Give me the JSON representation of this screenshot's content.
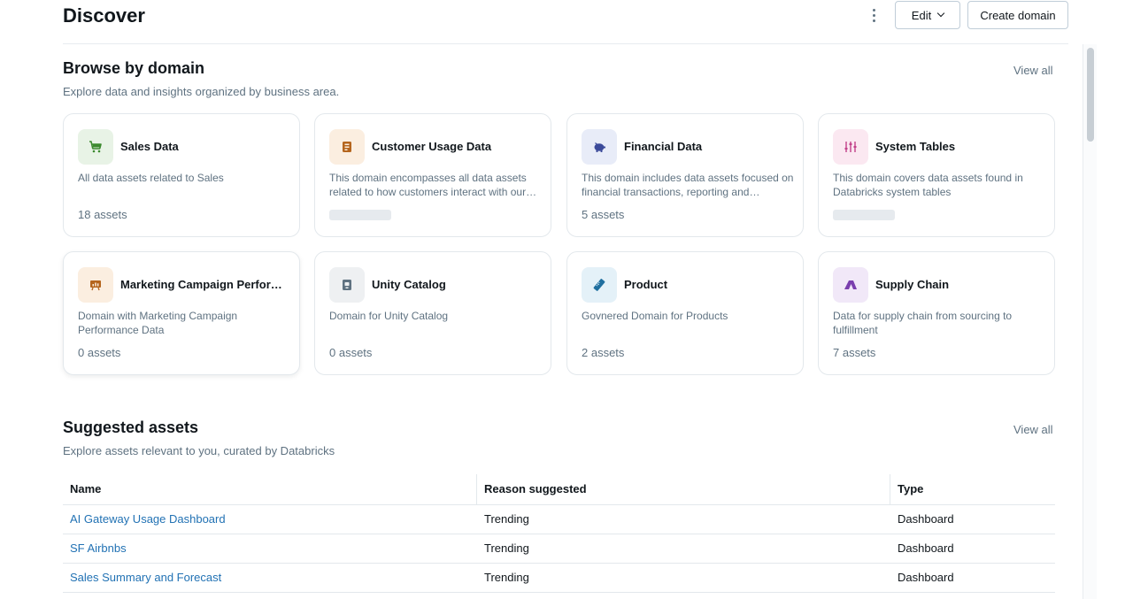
{
  "header": {
    "title": "Discover",
    "edit_label": "Edit",
    "create_label": "Create domain"
  },
  "browse": {
    "title": "Browse by domain",
    "subtitle": "Explore data and insights organized by business area.",
    "view_all": "View all",
    "domains": [
      {
        "name": "Sales Data",
        "description": "All data assets related to Sales",
        "count": "18 assets",
        "icon": "cart-icon",
        "icon_bg": "#e8f3e6",
        "icon_color": "#3b8a2e"
      },
      {
        "name": "Customer Usage Data",
        "description": "This domain encompasses all data assets related to how customers interact with our products and services",
        "count": "",
        "icon": "clipboard-icon",
        "icon_bg": "#fbeee0",
        "icon_color": "#b5651d"
      },
      {
        "name": "Financial Data",
        "description": "This domain includes data assets focused on financial transactions, reporting and budgeting",
        "count": "5 assets",
        "icon": "piggy-bank-icon",
        "icon_bg": "#e8ecf8",
        "icon_color": "#3b4a9a"
      },
      {
        "name": "System Tables",
        "description": "This domain covers data assets found in Databricks system tables",
        "count": "",
        "icon": "sliders-icon",
        "icon_bg": "#fbe8f1",
        "icon_color": "#c2408a"
      },
      {
        "name": "Marketing Campaign Performance",
        "description": "Domain with Marketing Campaign Performance Data",
        "count": "0 assets",
        "icon": "presentation-icon",
        "icon_bg": "#fbeee0",
        "icon_color": "#b5651d"
      },
      {
        "name": "Unity Catalog",
        "description": "Domain for Unity Catalog",
        "count": "0 assets",
        "icon": "catalog-icon",
        "icon_bg": "#eef0f2",
        "icon_color": "#5f7281"
      },
      {
        "name": "Product",
        "description": "Govnered Domain for Products",
        "count": "2 assets",
        "icon": "ruler-icon",
        "icon_bg": "#e4f1f8",
        "icon_color": "#1f6f9f"
      },
      {
        "name": "Supply Chain",
        "description": "Data for supply chain from sourcing to fulfillment",
        "count": "7 assets",
        "icon": "tent-icon",
        "icon_bg": "#f1e8f8",
        "icon_color": "#7a3fae"
      }
    ]
  },
  "suggested": {
    "title": "Suggested assets",
    "subtitle": "Explore assets relevant to you, curated by Databricks",
    "view_all": "View all",
    "columns": [
      "Name",
      "Reason suggested",
      "Type"
    ],
    "rows": [
      [
        "AI Gateway Usage Dashboard",
        "Trending",
        "Dashboard"
      ],
      [
        "SF Airbnbs",
        "Trending",
        "Dashboard"
      ],
      [
        "Sales Summary and Forecast",
        "Trending",
        "Dashboard"
      ]
    ]
  }
}
